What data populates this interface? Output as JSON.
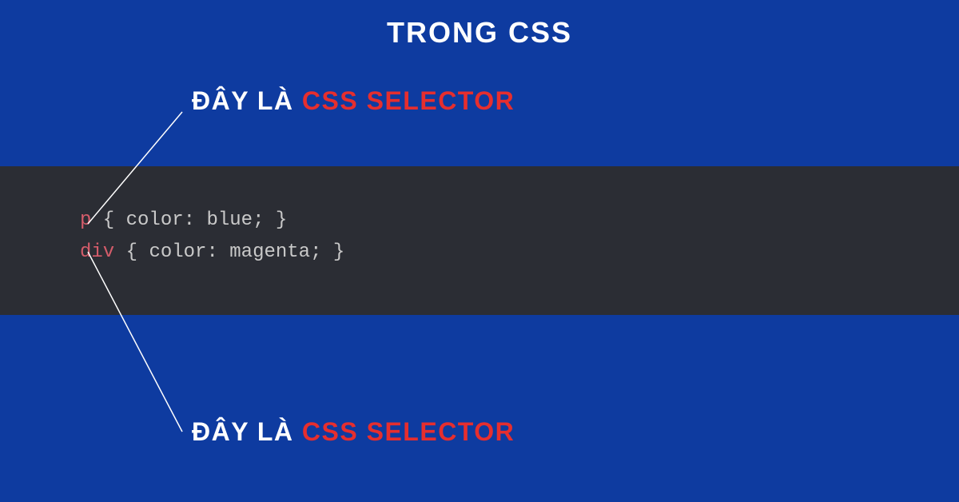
{
  "title": "TRONG CSS",
  "annotation_top": {
    "white": "ĐÂY LÀ ",
    "red": "CSS SELECTOR"
  },
  "annotation_bottom": {
    "white": "ĐÂY LÀ ",
    "red": "CSS SELECTOR"
  },
  "code": {
    "line1": {
      "selector": "p",
      "open": " { ",
      "prop": "color",
      "colon": ": ",
      "value": "blue",
      "semi": ";",
      "close": " }"
    },
    "line2": {
      "selector": "div",
      "open": " { ",
      "prop": "color",
      "colon": ": ",
      "value": "magenta",
      "semi": ";",
      "close": " }"
    }
  },
  "colors": {
    "background": "#0e3ba0",
    "code_bg": "#2b2d34",
    "white": "#ffffff",
    "red": "#e62e2e",
    "selector": "#d45c6a"
  }
}
